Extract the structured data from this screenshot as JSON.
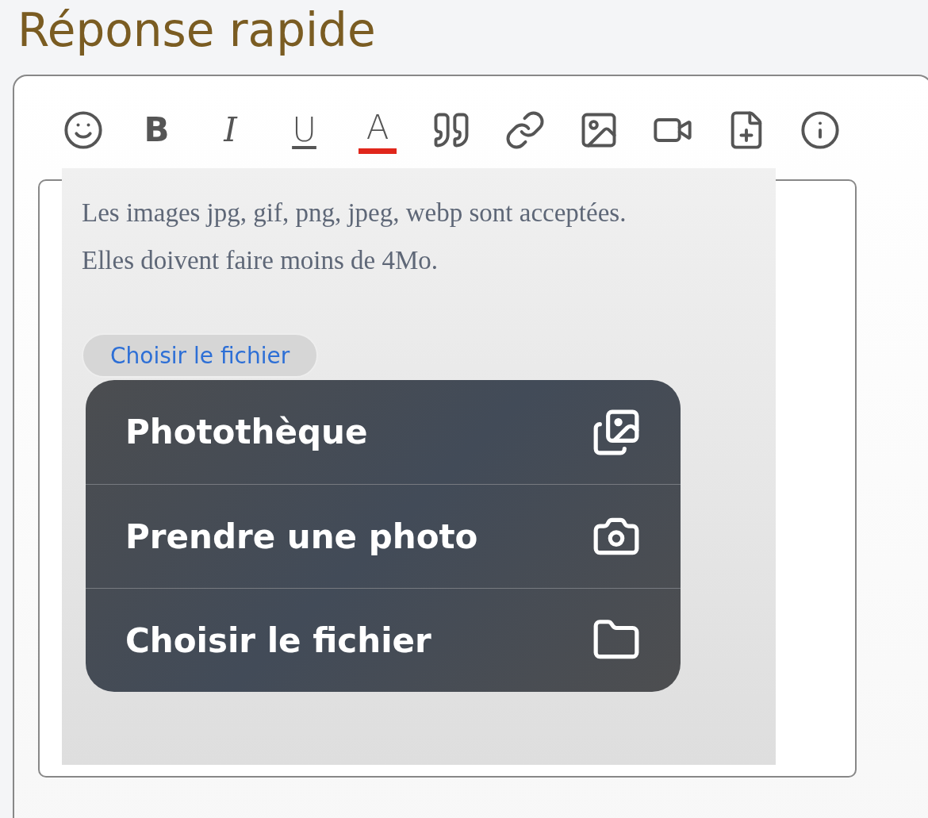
{
  "title": "Réponse rapide",
  "format_buttons": [
    {
      "label": "B"
    },
    {
      "label": "I"
    },
    {
      "label": "U"
    },
    {
      "label": "A",
      "color": "#e0261b"
    }
  ],
  "upload_panel": {
    "hint_lines": [
      "Les images jpg, gif, png, jpeg, webp sont acceptées.",
      "Elles doivent faire moins de 4Mo."
    ],
    "file_button": "Choisir le fichier",
    "menu": [
      {
        "label": "Photothèque"
      },
      {
        "label": "Prendre une photo"
      },
      {
        "label": "Choisir le fichier"
      }
    ]
  }
}
